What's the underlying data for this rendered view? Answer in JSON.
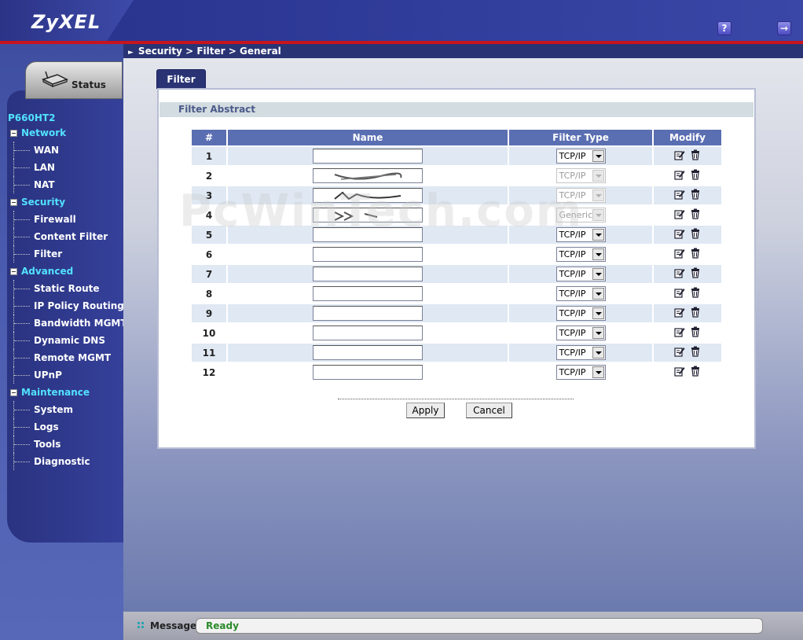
{
  "header": {
    "logo": "ZyXEL",
    "help_label": "?",
    "logout_label": "→"
  },
  "breadcrumb": "Security > Filter > General",
  "sidebar": {
    "status_label": "Status",
    "model": "P660HT2",
    "categories": [
      {
        "label": "Network",
        "items": [
          "WAN",
          "LAN",
          "NAT"
        ]
      },
      {
        "label": "Security",
        "items": [
          "Firewall",
          "Content Filter",
          "Filter"
        ]
      },
      {
        "label": "Advanced",
        "items": [
          "Static Route",
          "IP Policy Routing",
          "Bandwidth MGMT",
          "Dynamic DNS",
          "Remote MGMT",
          "UPnP"
        ]
      },
      {
        "label": "Maintenance",
        "items": [
          "System",
          "Logs",
          "Tools",
          "Diagnostic"
        ]
      }
    ]
  },
  "main": {
    "tab_label": "Filter",
    "section_title": "Filter Abstract",
    "table": {
      "headers": [
        "#",
        "Name",
        "Filter Type",
        "Modify"
      ],
      "rows": [
        {
          "num": "1",
          "name": "",
          "type": "TCP/IP",
          "disabled": false
        },
        {
          "num": "2",
          "name": "",
          "type": "TCP/IP",
          "disabled": true
        },
        {
          "num": "3",
          "name": "",
          "type": "TCP/IP",
          "disabled": true
        },
        {
          "num": "4",
          "name": "",
          "type": "Generic",
          "disabled": true
        },
        {
          "num": "5",
          "name": "",
          "type": "TCP/IP",
          "disabled": false
        },
        {
          "num": "6",
          "name": "",
          "type": "TCP/IP",
          "disabled": false
        },
        {
          "num": "7",
          "name": "",
          "type": "TCP/IP",
          "disabled": false
        },
        {
          "num": "8",
          "name": "",
          "type": "TCP/IP",
          "disabled": false
        },
        {
          "num": "9",
          "name": "",
          "type": "TCP/IP",
          "disabled": false
        },
        {
          "num": "10",
          "name": "",
          "type": "TCP/IP",
          "disabled": false
        },
        {
          "num": "11",
          "name": "",
          "type": "TCP/IP",
          "disabled": false
        },
        {
          "num": "12",
          "name": "",
          "type": "TCP/IP",
          "disabled": false
        }
      ]
    },
    "apply_label": "Apply",
    "cancel_label": "Cancel"
  },
  "statusbar": {
    "label": "Message",
    "message": "Ready"
  },
  "watermark": "PcWinTech.com",
  "colors": {
    "accent": "#2a3474",
    "header_bg": "#2c3894",
    "menu_category": "#52e2ff",
    "status_ok": "#2b8a2b",
    "divider_red": "#c8141e"
  }
}
